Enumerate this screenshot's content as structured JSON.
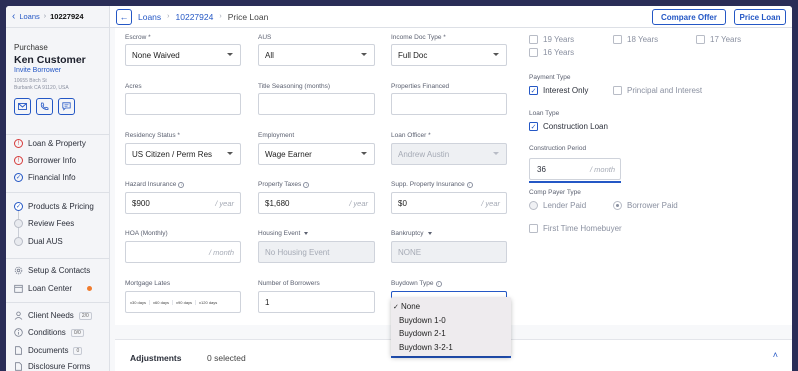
{
  "sidebar": {
    "back_link": "Loans",
    "loan_number": "10227924",
    "loan_type": "Purchase",
    "customer_name": "Ken Customer",
    "invite_label": "Invite Borrower",
    "address_line1": "10655 Birch St",
    "address_line2": "Burbank CA 91120, USA",
    "nav": {
      "loan_property": "Loan & Property",
      "borrower_info": "Borrower Info",
      "financial_info": "Financial Info",
      "products_pricing": "Products & Pricing",
      "review_fees": "Review Fees",
      "dual_aus": "Dual AUS",
      "setup_contacts": "Setup & Contacts",
      "loan_center": "Loan Center",
      "client_needs": "Client Needs",
      "client_needs_badge": "2/0",
      "conditions": "Conditions",
      "conditions_badge": "0/0",
      "documents": "Documents",
      "documents_badge": "0",
      "disclosure_forms": "Disclosure Forms"
    }
  },
  "topbar": {
    "crumb_loans": "Loans",
    "crumb_number": "10227924",
    "crumb_current": "Price Loan",
    "compare_offer": "Compare Offer",
    "price_loan": "Price Loan"
  },
  "form": {
    "escrow_label": "Escrow *",
    "escrow_value": "None Waived",
    "aus_label": "AUS",
    "aus_value": "All",
    "income_doc_label": "Income Doc Type *",
    "income_doc_value": "Full Doc",
    "acres_label": "Acres",
    "title_seasoning_label": "Title Seasoning (months)",
    "properties_financed_label": "Properties Financed",
    "residency_label": "Residency Status *",
    "residency_value": "US Citizen / Perm Res",
    "employment_label": "Employment",
    "employment_value": "Wage Earner",
    "loan_officer_label": "Loan Officer *",
    "loan_officer_value": "Andrew Austin",
    "hazard_label": "Hazard Insurance",
    "hazard_value": "$900",
    "hazard_suffix": "/ year",
    "property_taxes_label": "Property Taxes",
    "property_taxes_value": "$1,680",
    "property_taxes_suffix": "/ year",
    "supp_label": "Supp. Property Insurance",
    "supp_value": "$0",
    "supp_suffix": "/ year",
    "hoa_label": "HOA (Monthly)",
    "hoa_suffix": "/ month",
    "housing_event_label": "Housing Event",
    "housing_event_value": "No Housing Event",
    "bankruptcy_label": "Bankruptcy",
    "bankruptcy_value": "NONE",
    "mortgage_lates_label": "Mortgage Lates",
    "lates": [
      "x30 days",
      "x60 days",
      "x90 days",
      "x120 days"
    ],
    "num_borrowers_label": "Number of Borrowers",
    "num_borrowers_value": "1",
    "buydown_label": "Buydown Type",
    "buydown_options": [
      "None",
      "Buydown 1-0",
      "Buydown 2-1",
      "Buydown 3-2-1"
    ]
  },
  "right": {
    "years": [
      "19 Years",
      "18 Years",
      "17 Years",
      "16 Years"
    ],
    "payment_type_label": "Payment Type",
    "interest_only": "Interest Only",
    "principal_interest": "Principal and Interest",
    "loan_type_label": "Loan Type",
    "construction_loan": "Construction Loan",
    "construction_period_label": "Construction Period",
    "construction_period_value": "36",
    "construction_period_suffix": "/ month",
    "comp_payer_label": "Comp Payer Type",
    "lender_paid": "Lender Paid",
    "borrower_paid": "Borrower Paid",
    "first_time": "First Time Homebuyer"
  },
  "adjustments": {
    "title": "Adjustments",
    "count": "0 selected"
  }
}
